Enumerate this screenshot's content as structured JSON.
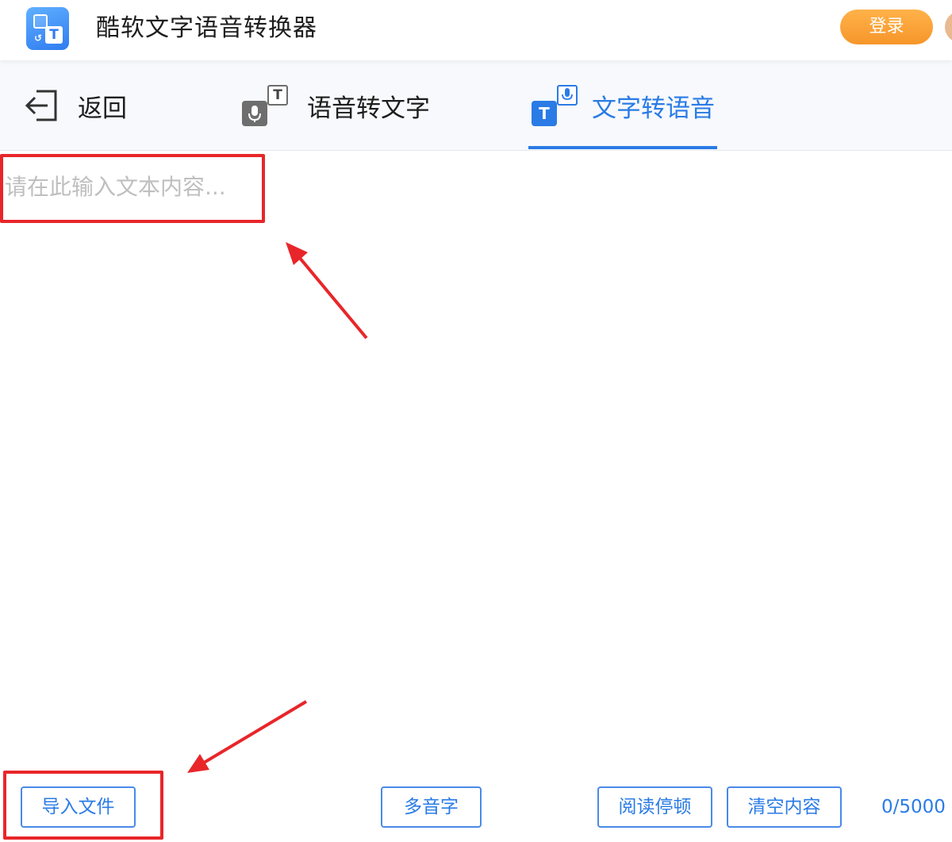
{
  "app": {
    "title": "酷软文字语音转换器",
    "login_label": "登录"
  },
  "nav": {
    "back_label": "返回",
    "tabs": [
      {
        "label": "语音转文字",
        "active": false,
        "icon_text": "T"
      },
      {
        "label": "文字转语音",
        "active": true,
        "icon_text": "T"
      }
    ]
  },
  "editor": {
    "placeholder": "请在此输入文本内容...",
    "value": ""
  },
  "toolbar": {
    "import_label": "导入文件",
    "polyphone_label": "多音字",
    "pause_label": "阅读停顿",
    "clear_label": "清空内容",
    "char_count": "0/5000"
  },
  "colors": {
    "accent": "#2a7be6",
    "login": "#f6962a",
    "annotation": "#e8262a"
  },
  "icons": {
    "app_logo": "app-logo-icon",
    "back": "back-arrow-icon",
    "speech_to_text": "mic-to-text-icon",
    "text_to_speech": "text-to-mic-icon"
  }
}
